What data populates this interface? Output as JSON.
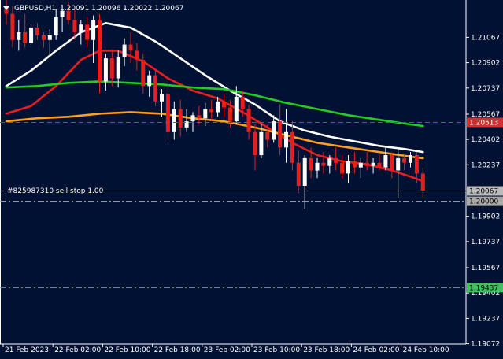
{
  "header": {
    "symbol": "GBPUSD,H1",
    "ohlc": "1.20091 1.20096 1.20022 1.20067"
  },
  "order_label": "#825987310 sell stop 1.00",
  "colors": {
    "background": "#001133",
    "bull": "#ffffff",
    "bear": "#e81e1e",
    "ma_fast": "#e81e1e",
    "ma_white": "#ffffff",
    "ma_green": "#22cc22",
    "ma_orange": "#ffa020",
    "price_line": "#bbbbbb",
    "red_level": "#d03030",
    "green_level": "#40c060",
    "axis": "#ffffff",
    "ask_line": "#aaaaaa"
  },
  "chart_data": {
    "type": "candlestick",
    "title": "GBPUSD,H1",
    "ylim": [
      1.1907,
      1.2131
    ],
    "y_ticks": [
      {
        "value": 1.21067,
        "label": "1.21067"
      },
      {
        "value": 1.20902,
        "label": "1.20902"
      },
      {
        "value": 1.20737,
        "label": "1.20737"
      },
      {
        "value": 1.20567,
        "label": "1.20567"
      },
      {
        "value": 1.20402,
        "label": "1.20402"
      },
      {
        "value": 1.20237,
        "label": "1.20237"
      },
      {
        "value": 1.19902,
        "label": "1.19902"
      },
      {
        "value": 1.19737,
        "label": "1.19737"
      },
      {
        "value": 1.19567,
        "label": "1.19567"
      },
      {
        "value": 1.19402,
        "label": "1.19402"
      },
      {
        "value": 1.19237,
        "label": "1.19237"
      },
      {
        "value": 1.19072,
        "label": "1.19072"
      }
    ],
    "x_ticks": [
      {
        "bar": 0,
        "label": "21 Feb 2023"
      },
      {
        "bar": 8,
        "label": "22 Feb 02:00"
      },
      {
        "bar": 16,
        "label": "22 Feb 10:00"
      },
      {
        "bar": 24,
        "label": "22 Feb 18:00"
      },
      {
        "bar": 32,
        "label": "23 Feb 02:00"
      },
      {
        "bar": 40,
        "label": "23 Feb 10:00"
      },
      {
        "bar": 48,
        "label": "23 Feb 18:00"
      },
      {
        "bar": 56,
        "label": "24 Feb 02:00"
      },
      {
        "bar": 64,
        "label": "24 Feb 10:00"
      }
    ],
    "ohlc": [
      [
        1.2125,
        1.2132,
        1.2115,
        1.2122
      ],
      [
        1.2122,
        1.2127,
        1.21,
        1.2105
      ],
      [
        1.2105,
        1.2118,
        1.2098,
        1.211
      ],
      [
        1.211,
        1.2122,
        1.21,
        1.2103
      ],
      [
        1.2103,
        1.2115,
        1.2102,
        1.2113
      ],
      [
        1.2113,
        1.2116,
        1.2105,
        1.2108
      ],
      [
        1.2108,
        1.211,
        1.21,
        1.2105
      ],
      [
        1.2105,
        1.2112,
        1.2095,
        1.2108
      ],
      [
        1.2108,
        1.2125,
        1.2105,
        1.212
      ],
      [
        1.212,
        1.2128,
        1.211,
        1.2124
      ],
      [
        1.2124,
        1.213,
        1.2115,
        1.2118
      ],
      [
        1.2118,
        1.2125,
        1.2105,
        1.211
      ],
      [
        1.211,
        1.2118,
        1.2102,
        1.2115
      ],
      [
        1.2115,
        1.212,
        1.21,
        1.2105
      ],
      [
        1.2105,
        1.2121,
        1.209,
        1.2118
      ],
      [
        1.2118,
        1.2122,
        1.207,
        1.2078
      ],
      [
        1.2078,
        1.2096,
        1.2072,
        1.2093
      ],
      [
        1.2093,
        1.2099,
        1.2075,
        1.208
      ],
      [
        1.208,
        1.2098,
        1.2074,
        1.2094
      ],
      [
        1.2094,
        1.2106,
        1.2088,
        1.2102
      ],
      [
        1.2102,
        1.211,
        1.209,
        1.2098
      ],
      [
        1.2098,
        1.2103,
        1.2085,
        1.2092
      ],
      [
        1.2092,
        1.2096,
        1.207,
        1.2075
      ],
      [
        1.2075,
        1.2085,
        1.2068,
        1.2082
      ],
      [
        1.2082,
        1.2086,
        1.2062,
        1.2065
      ],
      [
        1.2065,
        1.2073,
        1.2055,
        1.207
      ],
      [
        1.207,
        1.2075,
        1.204,
        1.2045
      ],
      [
        1.2045,
        1.2065,
        1.204,
        1.206
      ],
      [
        1.206,
        1.2066,
        1.2042,
        1.2048
      ],
      [
        1.2048,
        1.206,
        1.2045,
        1.2052
      ],
      [
        1.2052,
        1.2058,
        1.2045,
        1.2056
      ],
      [
        1.2056,
        1.2062,
        1.205,
        1.2054
      ],
      [
        1.2054,
        1.2064,
        1.2049,
        1.206
      ],
      [
        1.206,
        1.2066,
        1.2052,
        1.2058
      ],
      [
        1.2058,
        1.2068,
        1.2055,
        1.2065
      ],
      [
        1.2065,
        1.207,
        1.2055,
        1.2061
      ],
      [
        1.2061,
        1.2066,
        1.2048,
        1.2052
      ],
      [
        1.2052,
        1.2075,
        1.205,
        1.2068
      ],
      [
        1.2068,
        1.2072,
        1.2055,
        1.206
      ],
      [
        1.206,
        1.2063,
        1.204,
        1.2045
      ],
      [
        1.2045,
        1.205,
        1.202,
        1.203
      ],
      [
        1.203,
        1.205,
        1.2028,
        1.2045
      ],
      [
        1.2045,
        1.205,
        1.2035,
        1.204
      ],
      [
        1.204,
        1.2056,
        1.2038,
        1.2052
      ],
      [
        1.2052,
        1.2063,
        1.203,
        1.2035
      ],
      [
        1.2035,
        1.206,
        1.2025,
        1.2045
      ],
      [
        1.2045,
        1.2052,
        1.202,
        1.2025
      ],
      [
        1.2025,
        1.2033,
        1.2005,
        1.201
      ],
      [
        1.201,
        1.203,
        1.1995,
        1.2028
      ],
      [
        1.2028,
        1.2035,
        1.2015,
        1.202
      ],
      [
        1.202,
        1.2028,
        1.2015,
        1.2025
      ],
      [
        1.2025,
        1.2032,
        1.2018,
        1.2023
      ],
      [
        1.2023,
        1.203,
        1.2018,
        1.2028
      ],
      [
        1.2028,
        1.2035,
        1.202,
        1.2025
      ],
      [
        1.2025,
        1.203,
        1.2015,
        1.2018
      ],
      [
        1.2018,
        1.203,
        1.2012,
        1.2026
      ],
      [
        1.2026,
        1.2032,
        1.2018,
        1.2022
      ],
      [
        1.2022,
        1.2028,
        1.2015,
        1.2025
      ],
      [
        1.2025,
        1.2032,
        1.202,
        1.2023
      ],
      [
        1.2023,
        1.2028,
        1.2018,
        1.2025
      ],
      [
        1.2025,
        1.203,
        1.202,
        1.2022
      ],
      [
        1.2022,
        1.2035,
        1.202,
        1.203
      ],
      [
        1.203,
        1.2032,
        1.2015,
        1.202
      ],
      [
        1.202,
        1.2035,
        1.2002,
        1.2028
      ],
      [
        1.2028,
        1.203,
        1.202,
        1.2025
      ],
      [
        1.2025,
        1.2032,
        1.2022,
        1.203
      ],
      [
        1.203,
        1.2032,
        1.2012,
        1.2018
      ],
      [
        1.2018,
        1.2022,
        1.2002,
        1.2007
      ]
    ],
    "moving_averages": [
      {
        "color": "#ffffff",
        "points": [
          [
            0,
            1.2075
          ],
          [
            4,
            1.2085
          ],
          [
            8,
            1.2098
          ],
          [
            12,
            1.211
          ],
          [
            16,
            1.2116
          ],
          [
            20,
            1.2113
          ],
          [
            24,
            1.2104
          ],
          [
            28,
            1.2093
          ],
          [
            32,
            1.2082
          ],
          [
            36,
            1.2072
          ],
          [
            40,
            1.2063
          ],
          [
            44,
            1.2052
          ],
          [
            48,
            1.2046
          ],
          [
            52,
            1.2042
          ],
          [
            56,
            1.2039
          ],
          [
            60,
            1.2036
          ],
          [
            64,
            1.2034
          ],
          [
            67,
            1.2032
          ]
        ]
      },
      {
        "color": "#e81e1e",
        "points": [
          [
            0,
            1.2057
          ],
          [
            4,
            1.2062
          ],
          [
            8,
            1.2075
          ],
          [
            12,
            1.2092
          ],
          [
            15,
            1.2098
          ],
          [
            18,
            1.2098
          ],
          [
            22,
            1.2091
          ],
          [
            26,
            1.208
          ],
          [
            30,
            1.2072
          ],
          [
            34,
            1.2067
          ],
          [
            38,
            1.2058
          ],
          [
            42,
            1.2048
          ],
          [
            46,
            1.2038
          ],
          [
            50,
            1.203
          ],
          [
            54,
            1.2026
          ],
          [
            58,
            1.2024
          ],
          [
            62,
            1.202
          ],
          [
            65,
            1.2016
          ],
          [
            67,
            1.2013
          ]
        ]
      },
      {
        "color": "#22cc22",
        "points": [
          [
            0,
            1.2074
          ],
          [
            5,
            1.2075
          ],
          [
            10,
            1.2077
          ],
          [
            15,
            1.2078
          ],
          [
            20,
            1.2077
          ],
          [
            25,
            1.2076
          ],
          [
            30,
            1.2074
          ],
          [
            35,
            1.2073
          ],
          [
            40,
            1.2069
          ],
          [
            45,
            1.2064
          ],
          [
            50,
            1.206
          ],
          [
            55,
            1.2056
          ],
          [
            60,
            1.2053
          ],
          [
            65,
            1.205
          ],
          [
            67,
            1.2049
          ]
        ]
      },
      {
        "color": "#ffa020",
        "points": [
          [
            0,
            1.2052
          ],
          [
            5,
            1.2054
          ],
          [
            10,
            1.2055
          ],
          [
            15,
            1.2057
          ],
          [
            20,
            1.2058
          ],
          [
            25,
            1.2057
          ],
          [
            30,
            1.2054
          ],
          [
            35,
            1.2052
          ],
          [
            40,
            1.2048
          ],
          [
            45,
            1.2043
          ],
          [
            50,
            1.2038
          ],
          [
            55,
            1.2035
          ],
          [
            60,
            1.2032
          ],
          [
            65,
            1.2029
          ],
          [
            67,
            1.2028
          ]
        ]
      }
    ],
    "levels": [
      {
        "kind": "red",
        "value": 1.20513,
        "label": "1.20513",
        "style": "dashed",
        "color": "#d03030",
        "text_color": "#ffffff"
      },
      {
        "kind": "price",
        "value": 1.20067,
        "label": "1.20067",
        "style": "solid",
        "color": "#bbbbbb",
        "text_color": "#000000"
      },
      {
        "kind": "order",
        "value": 1.2,
        "label": "1.20000",
        "style": "dashdot",
        "color": "#aaaaaa",
        "text_color": "#000000"
      },
      {
        "kind": "green",
        "value": 1.19437,
        "label": "1.19437",
        "style": "dashdot",
        "color": "#40c060",
        "text_color": "#000000"
      }
    ]
  }
}
